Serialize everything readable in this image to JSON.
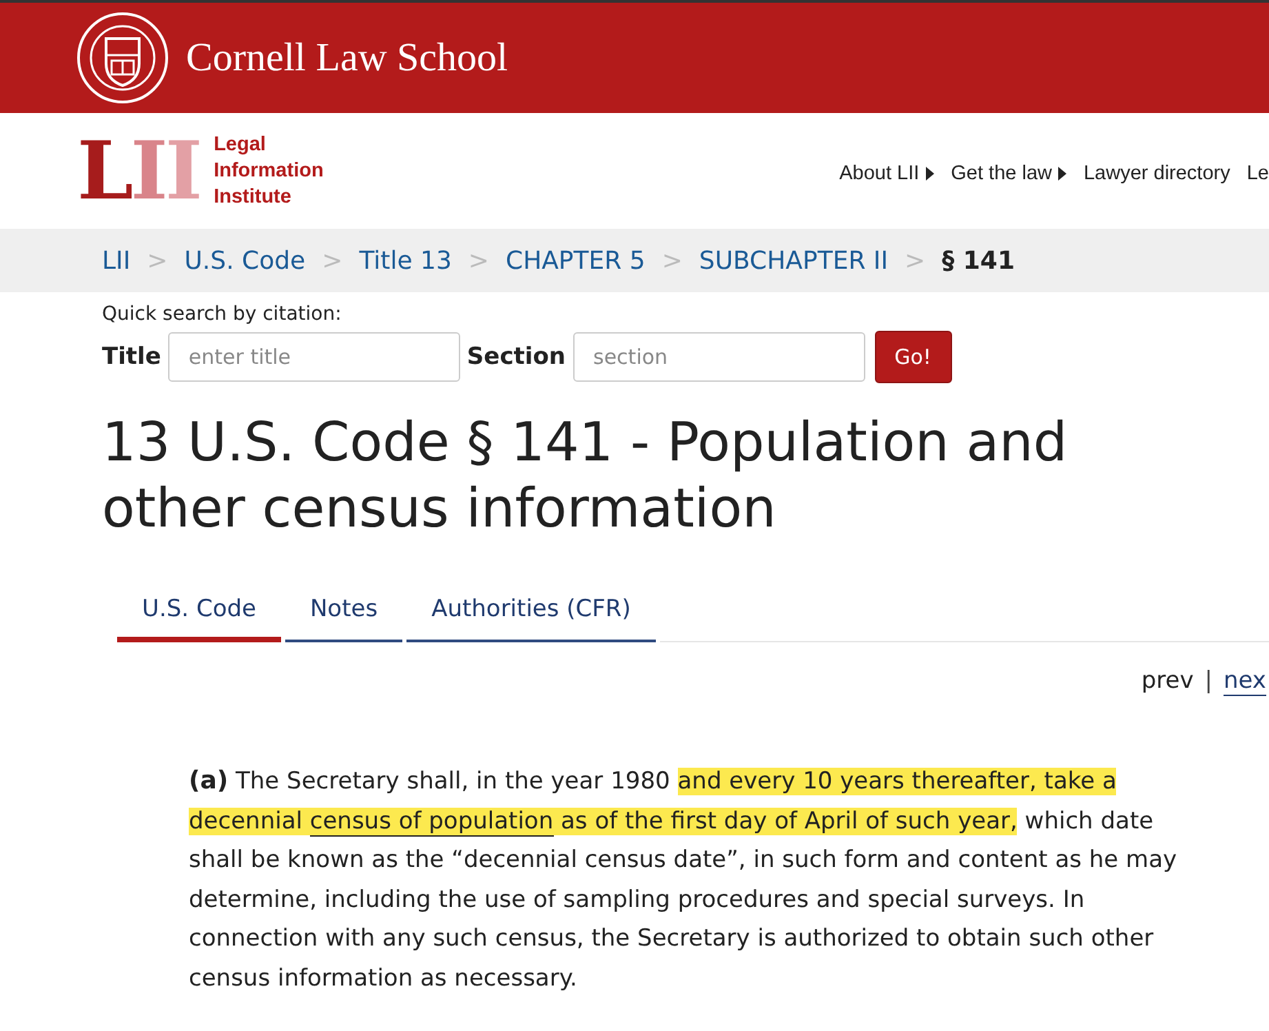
{
  "header": {
    "school": "Cornell Law School"
  },
  "brand": {
    "mark": "LII",
    "name_lines": [
      "Legal",
      "Information",
      "Institute"
    ]
  },
  "nav": [
    {
      "label": "About LII",
      "has_menu": true
    },
    {
      "label": "Get the law",
      "has_menu": true
    },
    {
      "label": "Lawyer directory",
      "has_menu": false
    },
    {
      "label": "Le",
      "has_menu": false
    }
  ],
  "breadcrumb": [
    {
      "label": "LII",
      "current": false
    },
    {
      "separator": ">",
      "label": "U.S. Code",
      "current": false
    },
    {
      "separator": ">",
      "label": "Title 13",
      "current": false
    },
    {
      "separator": ">",
      "label": "CHAPTER 5",
      "current": false
    },
    {
      "separator": ">",
      "label": "SUBCHAPTER II",
      "current": false
    },
    {
      "separator": ">",
      "label": "§ 141",
      "current": true
    }
  ],
  "quick_search": {
    "heading": "Quick search by citation:",
    "title_label": "Title",
    "title_placeholder": "enter title",
    "section_label": "Section",
    "section_placeholder": "section",
    "button": "Go!"
  },
  "page_title": "13 U.S. Code § 141 - Population and other census information",
  "tabs": [
    {
      "label": "U.S. Code",
      "selected": true
    },
    {
      "label": "Notes",
      "selected": false
    },
    {
      "label": "Authorities (CFR)",
      "selected": false
    }
  ],
  "pager": {
    "prev": "prev",
    "divider": "|",
    "next": "nex"
  },
  "paragraph": {
    "label": "(a)",
    "segments": [
      {
        "text": " The Secretary shall, in the year 1980 ",
        "highlighted": false,
        "link": false
      },
      {
        "text": "and every 10 years thereafter, take a decennial ",
        "highlighted": true,
        "link": false
      },
      {
        "text": "census of population",
        "highlighted": true,
        "link": true
      },
      {
        "text": " as of the first day of April of such year,",
        "highlighted": true,
        "link": false
      },
      {
        "text": " which date shall be known as the “decennial census date”, in such form and content as he may determine, including the use of sampling procedures and special surveys. In connection with any such census, the Secretary is authorized to obtain such other census information as necessary.",
        "highlighted": false,
        "link": false
      }
    ]
  }
}
